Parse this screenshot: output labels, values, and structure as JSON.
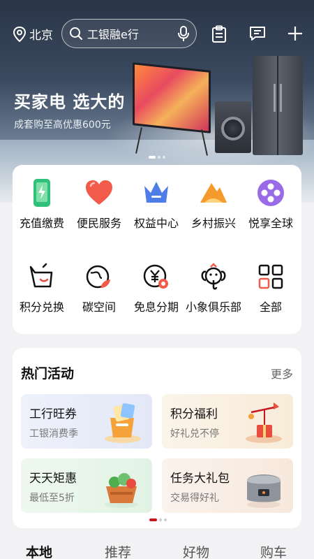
{
  "header": {
    "location": "北京",
    "search_placeholder": "工银融e行"
  },
  "banner": {
    "title": "买家电 选大的",
    "subtitle": "成套购至高优惠600元",
    "page_count": 3,
    "active_page": 1
  },
  "services": [
    {
      "label": "充值缴费",
      "icon": "phone-charge-icon"
    },
    {
      "label": "便民服务",
      "icon": "heart-icon"
    },
    {
      "label": "权益中心",
      "icon": "crown-icon"
    },
    {
      "label": "乡村振兴",
      "icon": "mountain-icon"
    },
    {
      "label": "悦享全球",
      "icon": "film-reel-icon"
    },
    {
      "label": "积分兑换",
      "icon": "cart-icon"
    },
    {
      "label": "碳空间",
      "icon": "globe-leaf-icon"
    },
    {
      "label": "免息分期",
      "icon": "yuan-clock-icon"
    },
    {
      "label": "小象俱乐部",
      "icon": "elephant-icon"
    },
    {
      "label": "全部",
      "icon": "grid-icon"
    }
  ],
  "activities": {
    "title": "热门活动",
    "more": "更多",
    "items": [
      {
        "title": "工行旺券",
        "subtitle": "工银消费季",
        "icon": "coupon-bag-icon"
      },
      {
        "title": "积分福利",
        "subtitle": "好礼兑不停",
        "icon": "gift-scale-icon"
      },
      {
        "title": "天天矩惠",
        "subtitle": "最低至5折",
        "icon": "vegetable-basket-icon"
      },
      {
        "title": "任务大礼包",
        "subtitle": "交易得好礼",
        "icon": "rice-cooker-icon"
      }
    ],
    "page_count": 3,
    "active_page": 1
  },
  "tabs": [
    {
      "label": "本地",
      "active": true
    },
    {
      "label": "推荐",
      "active": false
    },
    {
      "label": "好物",
      "active": false
    },
    {
      "label": "购车",
      "active": false
    }
  ],
  "colors": {
    "brand_red": "#c7161e"
  }
}
